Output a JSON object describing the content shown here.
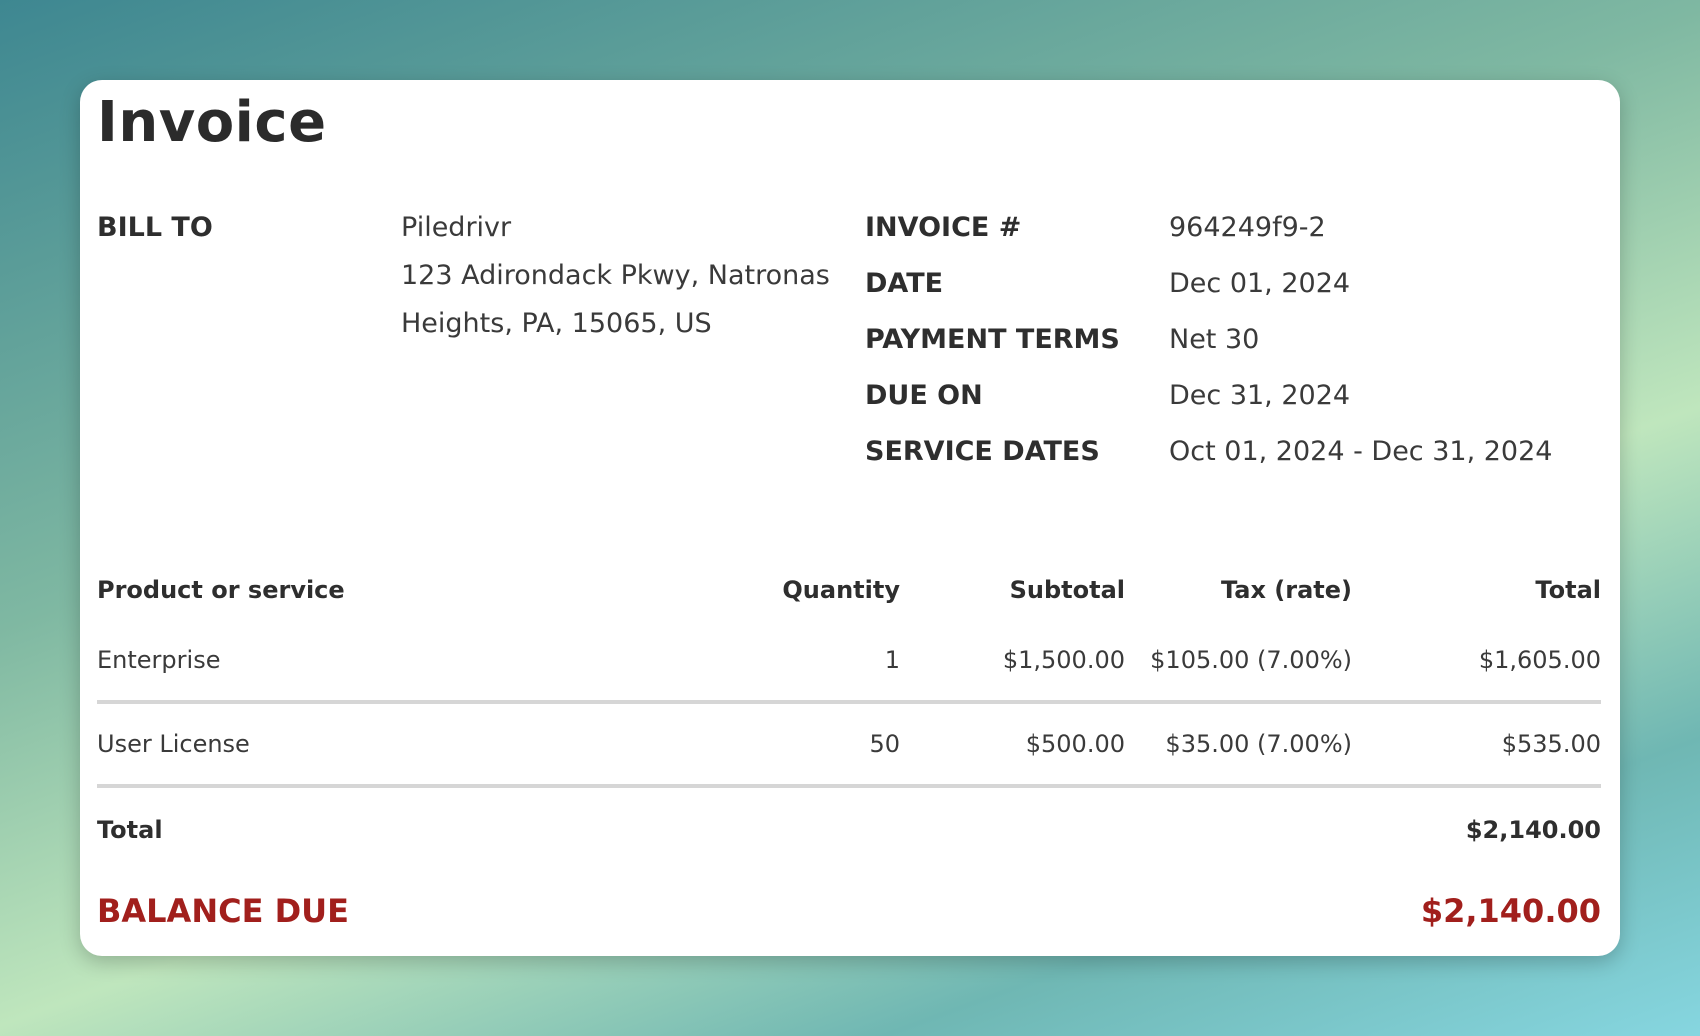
{
  "title": "Invoice",
  "bill_to": {
    "label": "BILL TO",
    "name": "Piledrivr",
    "address_line1": "123 Adirondack Pkwy, Natronas",
    "address_line2": "Heights, PA, 15065, US"
  },
  "meta": [
    {
      "label": "INVOICE #",
      "value": "964249f9-2"
    },
    {
      "label": "DATE",
      "value": "Dec 01, 2024"
    },
    {
      "label": "PAYMENT TERMS",
      "value": "Net 30"
    },
    {
      "label": "DUE ON",
      "value": "Dec 31, 2024"
    },
    {
      "label": "SERVICE DATES",
      "value": "Oct 01, 2024 - Dec 31, 2024"
    }
  ],
  "table": {
    "headers": [
      "Product or service",
      "Quantity",
      "Subtotal",
      "Tax (rate)",
      "Total"
    ],
    "rows": [
      [
        "Enterprise",
        "1",
        "$1,500.00",
        "$105.00 (7.00%)",
        "$1,605.00"
      ],
      [
        "User License",
        "50",
        "$500.00",
        "$35.00 (7.00%)",
        "$535.00"
      ]
    ],
    "total_label": "Total",
    "total_value": "$2,140.00"
  },
  "balance": {
    "label": "BALANCE DUE",
    "value": "$2,140.00",
    "color": "#a11f1c"
  }
}
